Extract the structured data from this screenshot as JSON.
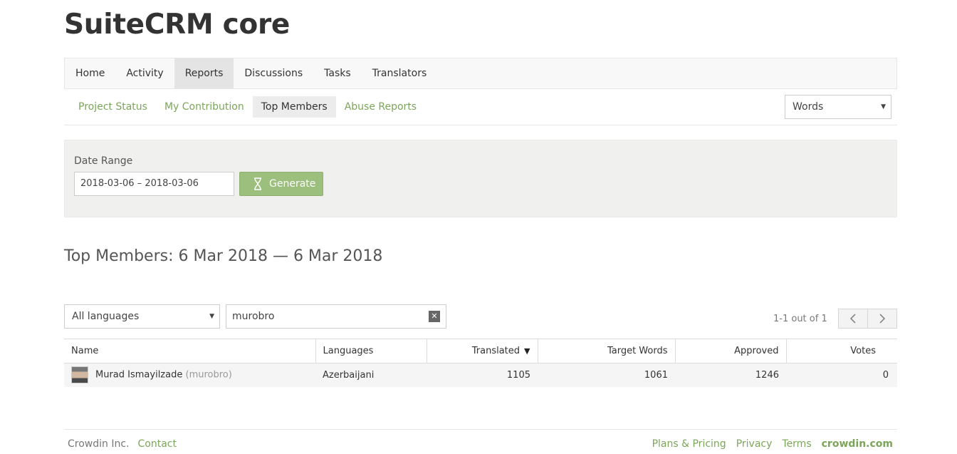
{
  "project": {
    "title": "SuiteCRM core"
  },
  "main_nav": {
    "items": [
      "Home",
      "Activity",
      "Reports",
      "Discussions",
      "Tasks",
      "Translators"
    ],
    "active": "Reports"
  },
  "sub_nav": {
    "items": [
      "Project Status",
      "My Contribution",
      "Top Members",
      "Abuse Reports"
    ],
    "active": "Top Members",
    "units_selected": "Words"
  },
  "filter": {
    "range_label": "Date Range",
    "range_value": "2018-03-06 – 2018-03-06",
    "generate_label": "Generate"
  },
  "report": {
    "heading": "Top Members: 6 Mar 2018 — 6 Mar 2018",
    "language_filter": "All languages",
    "search_value": "murobro",
    "page_info": "1-1 out of 1"
  },
  "table": {
    "columns": [
      "Name",
      "Languages",
      "Translated",
      "Target Words",
      "Approved",
      "Votes"
    ],
    "rows": [
      {
        "name": "Murad Ismayilzade",
        "username": "(murobro)",
        "languages": "Azerbaijani",
        "translated": "1105",
        "target_words": "1061",
        "approved": "1246",
        "votes": "0"
      }
    ]
  },
  "footer": {
    "company": "Crowdin Inc.",
    "contact": "Contact",
    "links": [
      "Plans & Pricing",
      "Privacy",
      "Terms"
    ],
    "brand": "crowdin.com"
  },
  "colors": {
    "accent_green": "#7ba65a",
    "button_green": "#9dbf7e"
  }
}
